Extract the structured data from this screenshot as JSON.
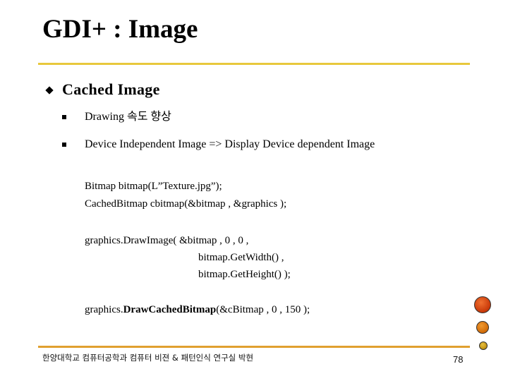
{
  "slide": {
    "title": "GDI+ : Image",
    "heading": "Cached Image",
    "bullets": [
      "Drawing 속도 향상",
      "Device Independent Image => Display Device dependent Image"
    ],
    "code": {
      "line1": "Bitmap bitmap(L”Texture.jpg”);",
      "line2": "CachedBitmap  cbitmap(&bitmap , &graphics );",
      "line3": "graphics.DrawImage( &bitmap , 0 , 0 ,",
      "line4": "bitmap.GetWidth() ,",
      "line5": "bitmap.GetHeight() );",
      "line6_prefix": "graphics.",
      "line6_bold": "DrawCachedBitmap",
      "line6_suffix": "(&cBitmap , 0 , 150 );"
    },
    "footer": "한양대학교 컴퓨터공학과  컴퓨터 비젼 & 패턴인식 연구실    박현",
    "page_number": "78"
  },
  "colors": {
    "top_rule": "#e8c83c",
    "bottom_rule": "#e0a030",
    "dot_large": "#d04810",
    "dot_medium": "#e07a10",
    "dot_small": "#d0a020"
  }
}
